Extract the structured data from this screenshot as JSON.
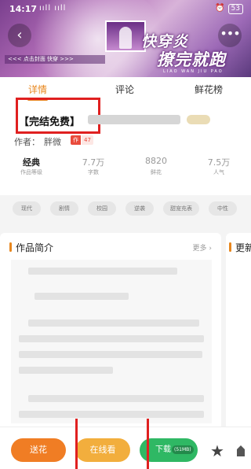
{
  "status_bar": {
    "time": "14:17",
    "signal": "ııll ııll",
    "battery": "53"
  },
  "banner": {
    "title_line1": "快穿炎",
    "title_line2": "撩完就跑",
    "title_pinyin": "LIAO WAN JIU PAO",
    "tagline": "<<< 点击封面 快穿 >>>"
  },
  "tabs": [
    "详情",
    "评论",
    "鲜花榜"
  ],
  "book": {
    "status_label": "【完结免费】",
    "author_label": "作者：",
    "author_name": "胖微",
    "level_tag": "作",
    "level_value": "47"
  },
  "stats": [
    {
      "value": "经典",
      "label": "作品等级"
    },
    {
      "value": "7.7万",
      "label": "字数"
    },
    {
      "value": "8820",
      "label": "鲜花"
    },
    {
      "value": "7.5万",
      "label": "人气"
    }
  ],
  "genres": [
    "现代",
    "剧情",
    "校园",
    "逆袭",
    "甜宠充表",
    "中性"
  ],
  "intro": {
    "title": "作品简介",
    "more": "更多 ›"
  },
  "update": {
    "title": "更新"
  },
  "actions": {
    "gift": "送花",
    "read": "在线看",
    "download": "下载",
    "download_size": "(51MB)"
  },
  "icons": {
    "star": "star-icon",
    "share": "share-icon"
  },
  "colors": {
    "accent": "#e8871e",
    "download": "#2fb864",
    "highlight_box": "#e02020"
  }
}
